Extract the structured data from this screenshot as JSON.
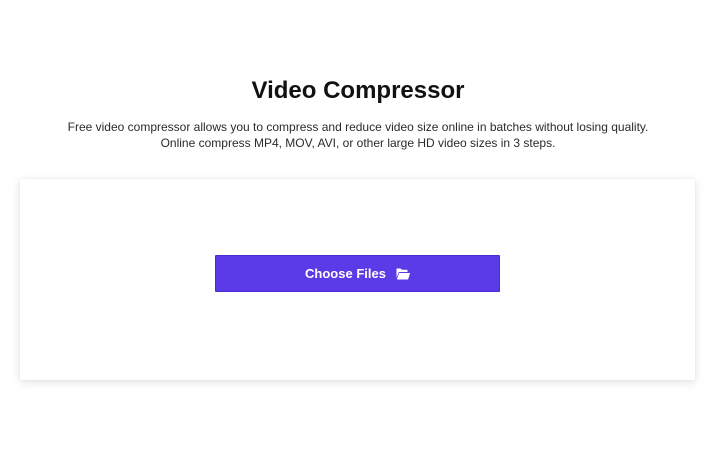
{
  "header": {
    "title": "Video Compressor",
    "description_line1": "Free video compressor allows you to compress and reduce video size online in batches without losing quality.",
    "description_line2": "Online compress MP4, MOV, AVI, or other large HD video sizes in 3 steps."
  },
  "upload": {
    "button_label": "Choose Files",
    "button_icon": "folder-open-icon",
    "button_color": "#5b3ae8"
  }
}
